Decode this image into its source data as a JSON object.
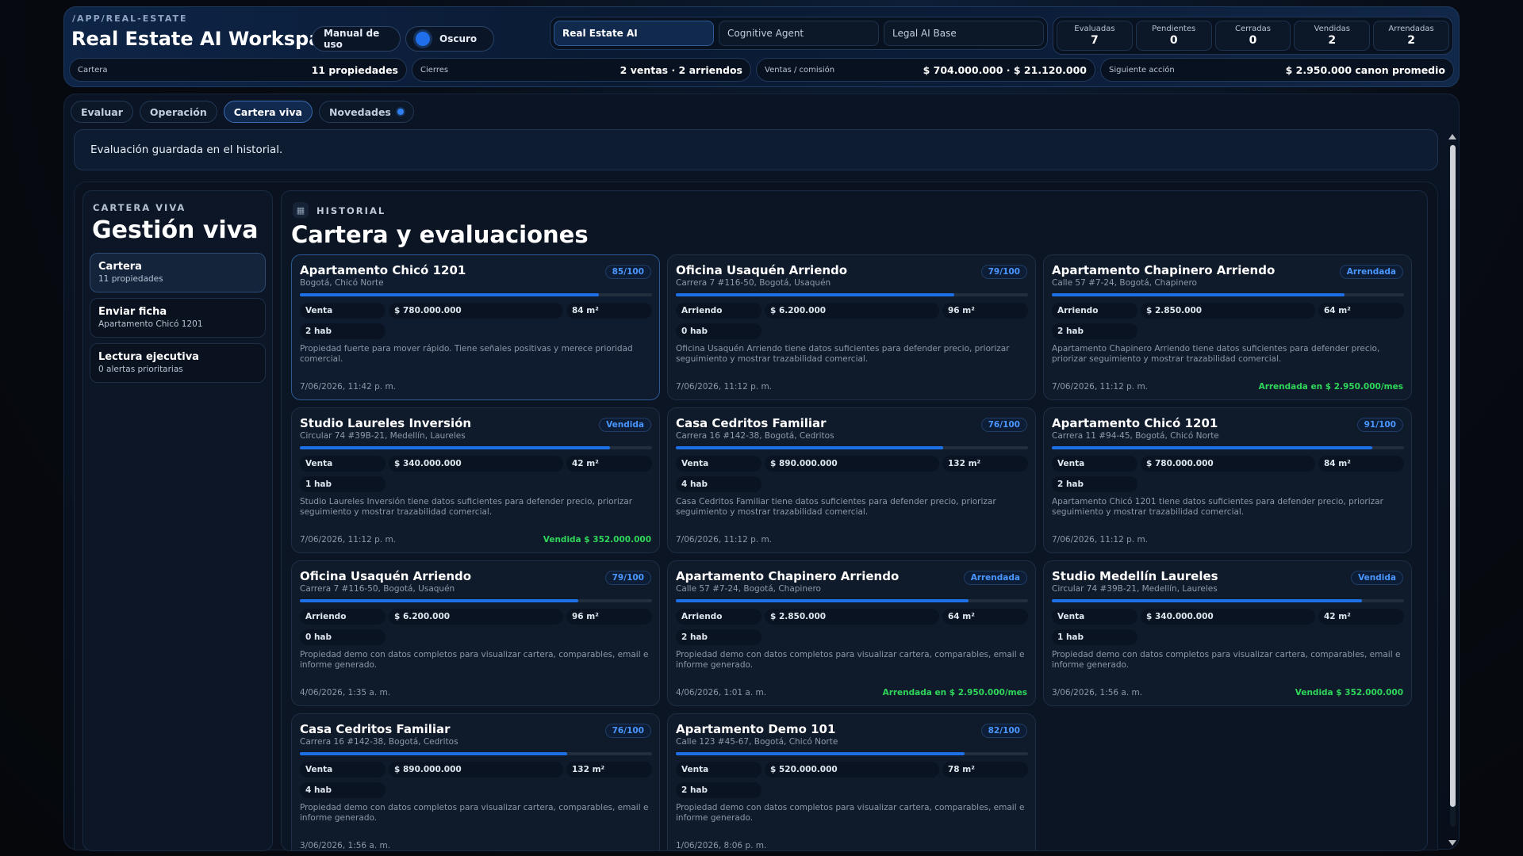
{
  "header": {
    "route": "/APP/REAL-ESTATE",
    "title": "Real Estate AI Workspace",
    "manual_label": "Manual de uso",
    "theme_label": "Oscuro",
    "agents": [
      "Real Estate AI",
      "Cognitive Agent",
      "Legal AI Base"
    ],
    "stats": [
      {
        "label": "Evaluadas",
        "value": "7"
      },
      {
        "label": "Pendientes",
        "value": "0"
      },
      {
        "label": "Cerradas",
        "value": "0"
      },
      {
        "label": "Vendidas",
        "value": "2"
      },
      {
        "label": "Arrendadas",
        "value": "2"
      }
    ],
    "summary": [
      {
        "label": "Cartera",
        "value": "11 propiedades"
      },
      {
        "label": "Cierres",
        "value": "2 ventas · 2 arriendos"
      },
      {
        "label": "Ventas / comisión",
        "value": "$ 704.000.000 · $ 21.120.000"
      },
      {
        "label": "Siguiente acción",
        "value": "$ 2.950.000 canon promedio"
      }
    ]
  },
  "tabs": [
    "Evaluar",
    "Operación",
    "Cartera viva",
    "Novedades"
  ],
  "toast": "Evaluación guardada en el historial.",
  "sidebar": {
    "kicker": "CARTERA VIVA",
    "title": "Gestión viva",
    "items": [
      {
        "title": "Cartera",
        "sub": "11 propiedades"
      },
      {
        "title": "Enviar ficha",
        "sub": "Apartamento Chicó 1201"
      },
      {
        "title": "Lectura ejecutiva",
        "sub": "0 alertas prioritarias"
      }
    ]
  },
  "content": {
    "kicker": "HISTORIAL",
    "title": "Cartera y evaluaciones",
    "cards": [
      {
        "title": "Apartamento Chicó 1201",
        "address": "Bogotá, Chicó Norte",
        "badge": "85/100",
        "progress": 0.85,
        "type": "Venta",
        "price": "$ 780.000.000",
        "area": "84 m²",
        "rooms": "2 hab",
        "desc": "Propiedad fuerte para mover rápido. Tiene señales positivas y merece prioridad comercial.",
        "date": "7/06/2026, 11:42 p. m.",
        "status": ""
      },
      {
        "title": "Oficina Usaquén Arriendo",
        "address": "Carrera 7 #116-50, Bogotá, Usaquén",
        "badge": "79/100",
        "progress": 0.79,
        "type": "Arriendo",
        "price": "$ 6.200.000",
        "area": "96 m²",
        "rooms": "0 hab",
        "desc": "Oficina Usaquén Arriendo tiene datos suficientes para defender precio, priorizar seguimiento y mostrar trazabilidad comercial.",
        "date": "7/06/2026, 11:12 p. m.",
        "status": ""
      },
      {
        "title": "Apartamento Chapinero Arriendo",
        "address": "Calle 57 #7-24, Bogotá, Chapinero",
        "badge": "Arrendada",
        "progress": 0.83,
        "type": "Arriendo",
        "price": "$ 2.850.000",
        "area": "64 m²",
        "rooms": "2 hab",
        "desc": "Apartamento Chapinero Arriendo tiene datos suficientes para defender precio, priorizar seguimiento y mostrar trazabilidad comercial.",
        "date": "7/06/2026, 11:12 p. m.",
        "status": "Arrendada en $ 2.950.000/mes"
      },
      {
        "title": "Studio Laureles Inversión",
        "address": "Circular 74 #39B-21, Medellín, Laureles",
        "badge": "Vendida",
        "progress": 0.88,
        "type": "Venta",
        "price": "$ 340.000.000",
        "area": "42 m²",
        "rooms": "1 hab",
        "desc": "Studio Laureles Inversión tiene datos suficientes para defender precio, priorizar seguimiento y mostrar trazabilidad comercial.",
        "date": "7/06/2026, 11:12 p. m.",
        "status": "Vendida $ 352.000.000"
      },
      {
        "title": "Casa Cedritos Familiar",
        "address": "Carrera 16 #142-38, Bogotá, Cedritos",
        "badge": "76/100",
        "progress": 0.76,
        "type": "Venta",
        "price": "$ 890.000.000",
        "area": "132 m²",
        "rooms": "4 hab",
        "desc": "Casa Cedritos Familiar tiene datos suficientes para defender precio, priorizar seguimiento y mostrar trazabilidad comercial.",
        "date": "7/06/2026, 11:12 p. m.",
        "status": ""
      },
      {
        "title": "Apartamento Chicó 1201",
        "address": "Carrera 11 #94-45, Bogotá, Chicó Norte",
        "badge": "91/100",
        "progress": 0.91,
        "type": "Venta",
        "price": "$ 780.000.000",
        "area": "84 m²",
        "rooms": "2 hab",
        "desc": "Apartamento Chicó 1201 tiene datos suficientes para defender precio, priorizar seguimiento y mostrar trazabilidad comercial.",
        "date": "7/06/2026, 11:12 p. m.",
        "status": ""
      },
      {
        "title": "Oficina Usaquén Arriendo",
        "address": "Carrera 7 #116-50, Bogotá, Usaquén",
        "badge": "79/100",
        "progress": 0.79,
        "type": "Arriendo",
        "price": "$ 6.200.000",
        "area": "96 m²",
        "rooms": "0 hab",
        "desc": "Propiedad demo con datos completos para visualizar cartera, comparables, email e informe generado.",
        "date": "4/06/2026, 1:35 a. m.",
        "status": ""
      },
      {
        "title": "Apartamento Chapinero Arriendo",
        "address": "Calle 57 #7-24, Bogotá, Chapinero",
        "badge": "Arrendada",
        "progress": 0.83,
        "type": "Arriendo",
        "price": "$ 2.850.000",
        "area": "64 m²",
        "rooms": "2 hab",
        "desc": "Propiedad demo con datos completos para visualizar cartera, comparables, email e informe generado.",
        "date": "4/06/2026, 1:01 a. m.",
        "status": "Arrendada en $ 2.950.000/mes"
      },
      {
        "title": "Studio Medellín Laureles",
        "address": "Circular 74 #39B-21, Medellín, Laureles",
        "badge": "Vendida",
        "progress": 0.88,
        "type": "Venta",
        "price": "$ 340.000.000",
        "area": "42 m²",
        "rooms": "1 hab",
        "desc": "Propiedad demo con datos completos para visualizar cartera, comparables, email e informe generado.",
        "date": "3/06/2026, 1:56 a. m.",
        "status": "Vendida $ 352.000.000"
      },
      {
        "title": "Casa Cedritos Familiar",
        "address": "Carrera 16 #142-38, Bogotá, Cedritos",
        "badge": "76/100",
        "progress": 0.76,
        "type": "Venta",
        "price": "$ 890.000.000",
        "area": "132 m²",
        "rooms": "4 hab",
        "desc": "Propiedad demo con datos completos para visualizar cartera, comparables, email e informe generado.",
        "date": "3/06/2026, 1:56 a. m.",
        "status": ""
      },
      {
        "title": "Apartamento Demo 101",
        "address": "Calle 123 #45-67, Bogotá, Chicó Norte",
        "badge": "82/100",
        "progress": 0.82,
        "type": "Venta",
        "price": "$ 520.000.000",
        "area": "78 m²",
        "rooms": "2 hab",
        "desc": "Propiedad demo con datos completos para visualizar cartera, comparables, email e informe generado.",
        "date": "1/06/2026, 8:06 p. m.",
        "status": ""
      }
    ]
  },
  "colors": {
    "accent": "#1e70e8",
    "success": "#2fd65a",
    "badge_text": "#4a96ff"
  }
}
